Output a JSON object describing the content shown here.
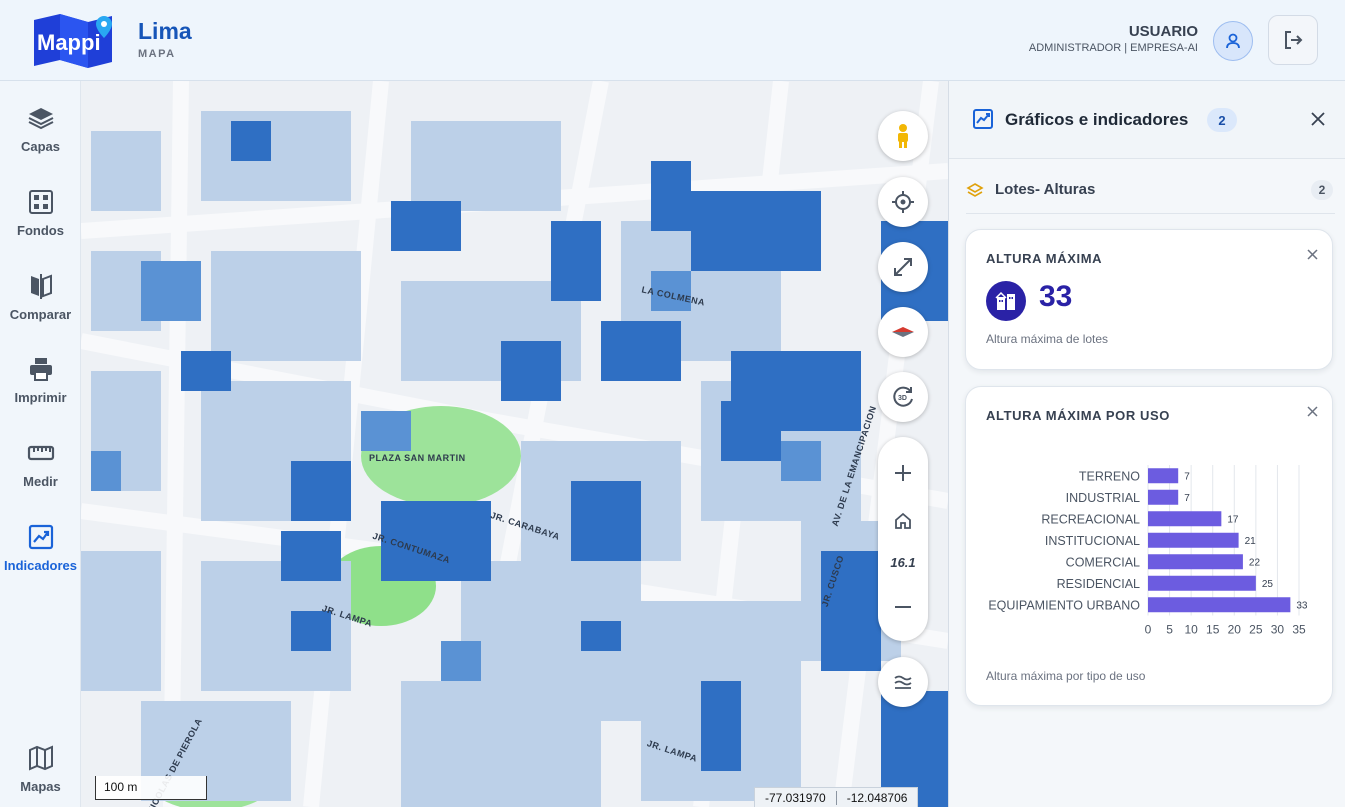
{
  "header": {
    "logo_text": "Mappi",
    "city": "Lima",
    "subtitle": "MAPA",
    "user_name": "USUARIO",
    "user_role": "ADMINISTRADOR | EMPRESA-AI"
  },
  "sidebar": {
    "items": [
      {
        "label": "Capas",
        "icon": "layers-icon"
      },
      {
        "label": "Fondos",
        "icon": "grid-icon"
      },
      {
        "label": "Comparar",
        "icon": "compare-icon"
      },
      {
        "label": "Imprimir",
        "icon": "printer-icon"
      },
      {
        "label": "Medir",
        "icon": "ruler-icon"
      },
      {
        "label": "Indicadores",
        "icon": "chart-icon",
        "active": true
      },
      {
        "label": "Mapas",
        "icon": "map-icon"
      }
    ]
  },
  "map": {
    "zoom": "16.1",
    "scale": "100 m",
    "lon": "-77.031970",
    "lat": "-12.048706",
    "labels": {
      "plaza": "PLAZA SAN MARTIN",
      "contumaza": "JR. CONTUMAZA",
      "carabaya": "JR. CARABAYA",
      "lampa1": "JR. LAMPA",
      "lampa2": "JR. LAMPA",
      "pierola": "NICOLAS DE PIEROLA",
      "cusco": "JR. CUSCO",
      "emancipacion": "AV. DE LA EMANCIPACION",
      "colmena": "LA COLMENA"
    }
  },
  "panel": {
    "title": "Gráficos e indicadores",
    "count": "2",
    "layer": {
      "name": "Lotes- Alturas",
      "count": "2"
    },
    "kpi": {
      "title": "ALTURA MÁXIMA",
      "value": "33",
      "caption": "Altura máxima de lotes"
    },
    "chart_card": {
      "title": "ALTURA MÁXIMA POR USO",
      "caption": "Altura máxima por tipo de uso"
    }
  },
  "chart_data": {
    "type": "bar",
    "orientation": "horizontal",
    "categories": [
      "TERRENO",
      "INDUSTRIAL",
      "RECREACIONAL",
      "INSTITUCIONAL",
      "COMERCIAL",
      "RESIDENCIAL",
      "EQUIPAMIENTO URBANO"
    ],
    "values": [
      7,
      7,
      17,
      21,
      22,
      25,
      33
    ],
    "xlim": [
      0,
      35
    ],
    "xticks": [
      0,
      5,
      10,
      15,
      20,
      25,
      30,
      35
    ],
    "bar_color": "#6c5ce0",
    "grid": true
  }
}
